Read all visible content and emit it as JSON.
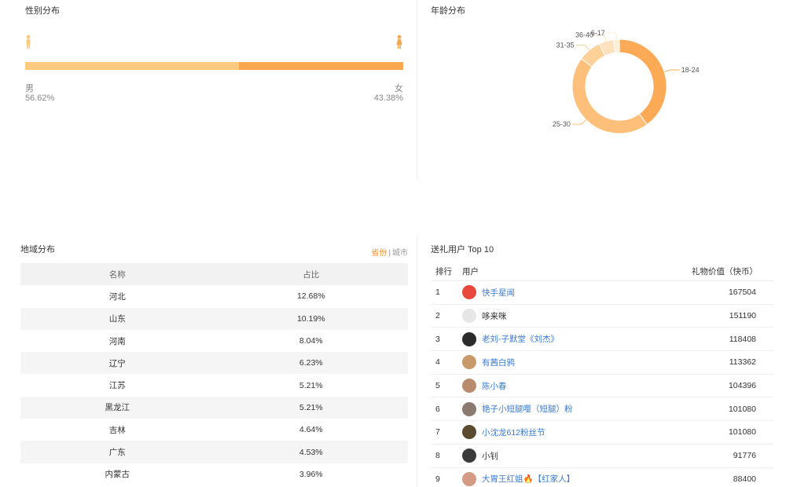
{
  "gender": {
    "title": "性别分布",
    "male": {
      "label": "男",
      "percent": "56.62%",
      "value": 56.62,
      "color": "#fcc981"
    },
    "female": {
      "label": "女",
      "percent": "43.38%",
      "value": 43.38,
      "color": "#f9a84f"
    }
  },
  "age": {
    "title": "年龄分布",
    "segments": [
      {
        "label": "18-24",
        "value": 40,
        "color": "#fdaa56"
      },
      {
        "label": "25-30",
        "value": 45,
        "color": "#fdbf7a"
      },
      {
        "label": "31-35",
        "value": 8,
        "color": "#fed199"
      },
      {
        "label": "36-40",
        "value": 5,
        "color": "#fee1bd"
      },
      {
        "label": "6-17",
        "value": 2,
        "color": "#fdeed8"
      }
    ]
  },
  "region": {
    "title": "地域分布",
    "tab_province": "省份",
    "tab_separator": "|",
    "tab_city": "城市",
    "col_name": "名称",
    "col_ratio": "占比",
    "rows": [
      {
        "name": "河北",
        "ratio": "12.68%"
      },
      {
        "name": "山东",
        "ratio": "10.19%"
      },
      {
        "name": "河南",
        "ratio": "8.04%"
      },
      {
        "name": "辽宁",
        "ratio": "6.23%"
      },
      {
        "name": "江苏",
        "ratio": "5.21%"
      },
      {
        "name": "黑龙江",
        "ratio": "5.21%"
      },
      {
        "name": "吉林",
        "ratio": "4.64%"
      },
      {
        "name": "广东",
        "ratio": "4.53%"
      },
      {
        "name": "内蒙古",
        "ratio": "3.96%"
      }
    ]
  },
  "gifts": {
    "title": "送礼用户 Top 10",
    "col_rank": "排行",
    "col_user": "用户",
    "col_value": "礼物价值（快币）",
    "rows": [
      {
        "rank": "1",
        "user": "快手星闻",
        "value": "167504",
        "link": true,
        "avatar_color": "#e8473c"
      },
      {
        "rank": "2",
        "user": "哆来咪",
        "value": "151190",
        "link": false,
        "avatar_color": "#e6e6e6"
      },
      {
        "rank": "3",
        "user": "老刘-子默堂《刘杰》",
        "value": "118408",
        "link": true,
        "avatar_color": "#2b2b2b"
      },
      {
        "rank": "4",
        "user": "有茜白鸦",
        "value": "113362",
        "link": true,
        "avatar_color": "#c89a6a"
      },
      {
        "rank": "5",
        "user": "陈小春",
        "value": "104396",
        "link": true,
        "avatar_color": "#b98b6e"
      },
      {
        "rank": "6",
        "user": "艳子小短腿嘤（短腿）粉",
        "value": "101080",
        "link": true,
        "avatar_color": "#8a7a70"
      },
      {
        "rank": "7",
        "user": "小沈龙612粉丝节",
        "value": "101080",
        "link": true,
        "avatar_color": "#5a4a30"
      },
      {
        "rank": "8",
        "user": "小钊",
        "value": "91776",
        "link": false,
        "avatar_color": "#3b3b3b"
      },
      {
        "rank": "9",
        "user": "大胃王红姐🔥【红家人】",
        "value": "88400",
        "link": true,
        "avatar_color": "#d49a84"
      }
    ]
  }
}
